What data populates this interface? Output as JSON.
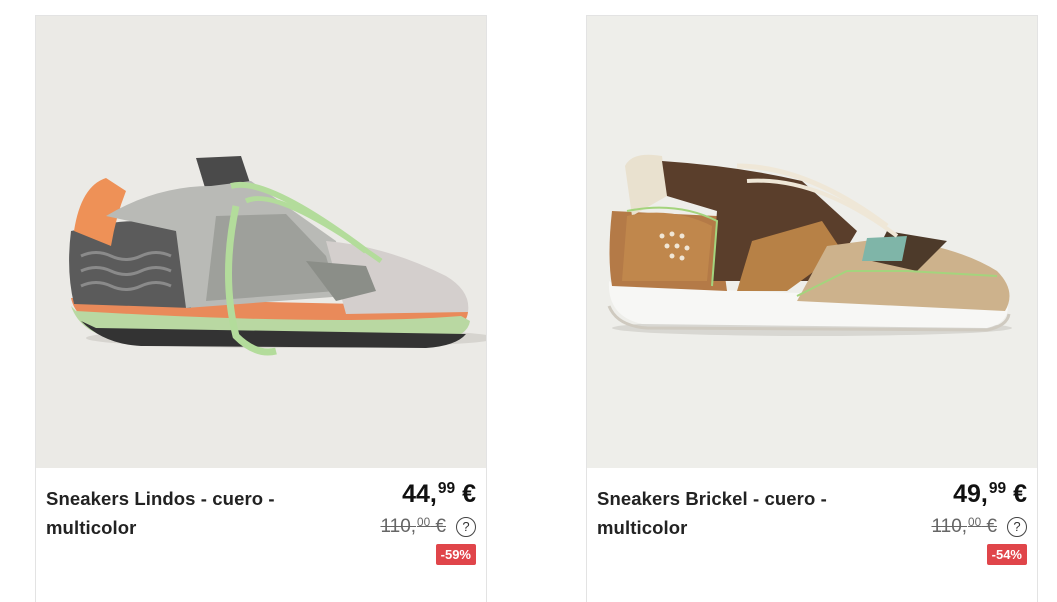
{
  "products": [
    {
      "title": "Sneakers Lindos - cuero - multicolor",
      "price_main": "44,",
      "price_cents": "99",
      "price_currency": " €",
      "old_main": "110,",
      "old_cents": "00",
      "old_currency": " €",
      "help": "?",
      "discount": "-59%",
      "image_icon": "sneaker-lindos-image"
    },
    {
      "title": "Sneakers Brickel - cuero - multicolor",
      "price_main": "49,",
      "price_cents": "99",
      "price_currency": " €",
      "old_main": "110,",
      "old_cents": "00",
      "old_currency": " €",
      "help": "?",
      "discount": "-54%",
      "image_icon": "sneaker-brickel-image"
    }
  ],
  "colors": {
    "badge": "#e0454a",
    "image_bg": "#ebeae6"
  }
}
